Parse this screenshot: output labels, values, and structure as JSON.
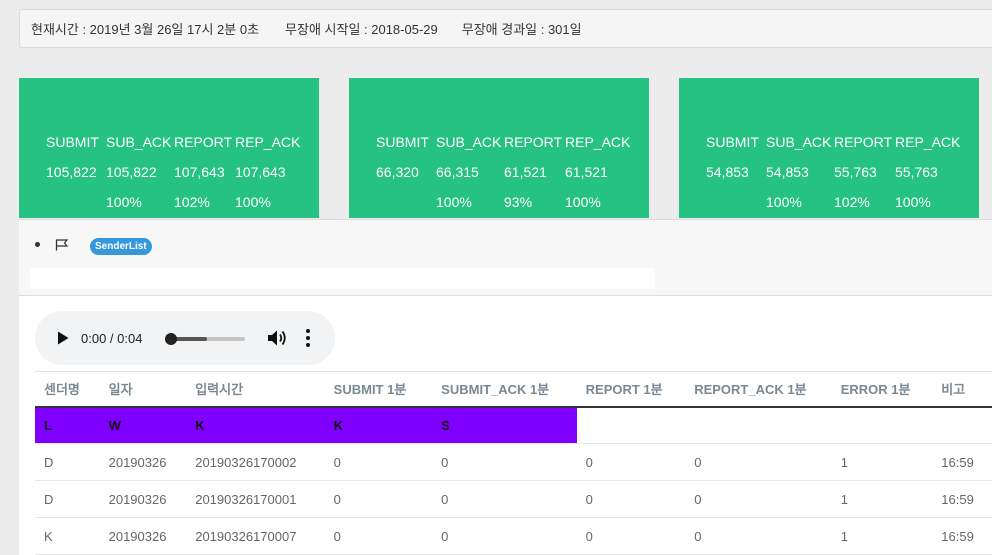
{
  "status": {
    "current_time": "현재시간 : 2019년 3월 26일 17시 2분 0초",
    "start_date": "무장애 시작일 : 2018-05-29",
    "elapsed_days": "무장애 경과일 : 301일"
  },
  "colors": {
    "card_bg": "#26c281",
    "highlight_row": "#8000ff",
    "badge": "#3598dc"
  },
  "cards": [
    {
      "headers": [
        "SUBMIT",
        "SUB_ACK",
        "REPORT",
        "REP_ACK"
      ],
      "values": [
        "105,822",
        "105,822",
        "107,643",
        "107,643"
      ],
      "percents": [
        "",
        "100%",
        "102%",
        "100%"
      ]
    },
    {
      "headers": [
        "SUBMIT",
        "SUB_ACK",
        "REPORT",
        "REP_ACK"
      ],
      "values": [
        "66,320",
        "66,315",
        "61,521",
        "61,521"
      ],
      "percents": [
        "",
        "100%",
        "93%",
        "100%"
      ]
    },
    {
      "headers": [
        "SUBMIT",
        "SUB_ACK",
        "REPORT",
        "REP_ACK"
      ],
      "values": [
        "54,853",
        "54,853",
        "55,763",
        "55,763"
      ],
      "percents": [
        "",
        "100%",
        "102%",
        "100%"
      ]
    }
  ],
  "panel": {
    "badge_label": "SenderList",
    "icons": [
      "bullet-dot",
      "flag-icon"
    ]
  },
  "audio": {
    "time": "0:00 / 0:04",
    "progress": 0.0,
    "icons": [
      "play-icon",
      "volume-icon",
      "more-vert-icon"
    ]
  },
  "table": {
    "headers": [
      "센더명",
      "일자",
      "입력시간",
      "SUBMIT 1분",
      "SUBMIT_ACK 1분",
      "REPORT 1분",
      "REPORT_ACK 1분",
      "ERROR 1분",
      "비고"
    ],
    "highlight_row": [
      "L",
      "W",
      "K",
      "K",
      "S",
      "",
      "",
      "",
      ""
    ],
    "rows": [
      [
        "D",
        "20190326",
        "20190326170002",
        "0",
        "0",
        "0",
        "0",
        "1",
        "16:59"
      ],
      [
        "D",
        "20190326",
        "20190326170001",
        "0",
        "0",
        "0",
        "0",
        "1",
        "16:59"
      ],
      [
        "K",
        "20190326",
        "20190326170007",
        "0",
        "0",
        "0",
        "0",
        "1",
        "16:59"
      ]
    ]
  }
}
